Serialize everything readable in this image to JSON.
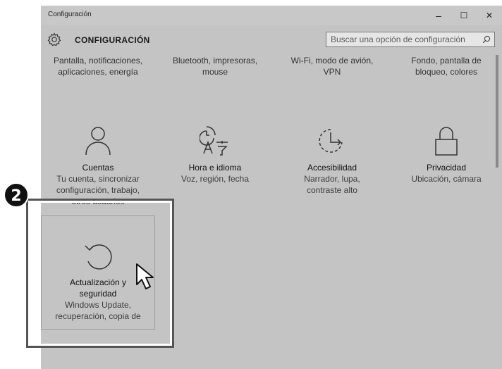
{
  "window": {
    "title": "Configuración",
    "minimize_symbol": "–",
    "maximize_symbol": "☐",
    "close_symbol": "✕"
  },
  "header": {
    "app_title": "CONFIGURACIÓN",
    "search_placeholder": "Buscar una opción de configuración"
  },
  "top_tiles": [
    {
      "desc": "Pantalla, notificaciones,\naplicaciones, energía"
    },
    {
      "desc": "Bluetooth, impresoras,\nmouse"
    },
    {
      "desc": "Wi-Fi, modo de avión,\nVPN"
    },
    {
      "desc": "Fondo, pantalla de\nbloqueo, colores"
    }
  ],
  "tiles": [
    {
      "name": "Cuentas",
      "desc": "Tu cuenta, sincronizar\nconfiguración, trabajo,\notros usuarios",
      "icon": "person-icon"
    },
    {
      "name": "Hora e idioma",
      "desc": "Voz, región, fecha",
      "icon": "time-language-icon"
    },
    {
      "name": "Accesibilidad",
      "desc": "Narrador, lupa,\ncontraste alto",
      "icon": "ease-of-access-icon"
    },
    {
      "name": "Privacidad",
      "desc": "Ubicación, cámara",
      "icon": "lock-icon"
    }
  ],
  "update_tile": {
    "name": "Actualización y\nseguridad",
    "desc": "Windows Update,\nrecuperación, copia de",
    "icon": "refresh-icon"
  },
  "annotation": {
    "step_number": "2",
    "badge_color": "#111111",
    "highlight_color": "#ffffff"
  }
}
